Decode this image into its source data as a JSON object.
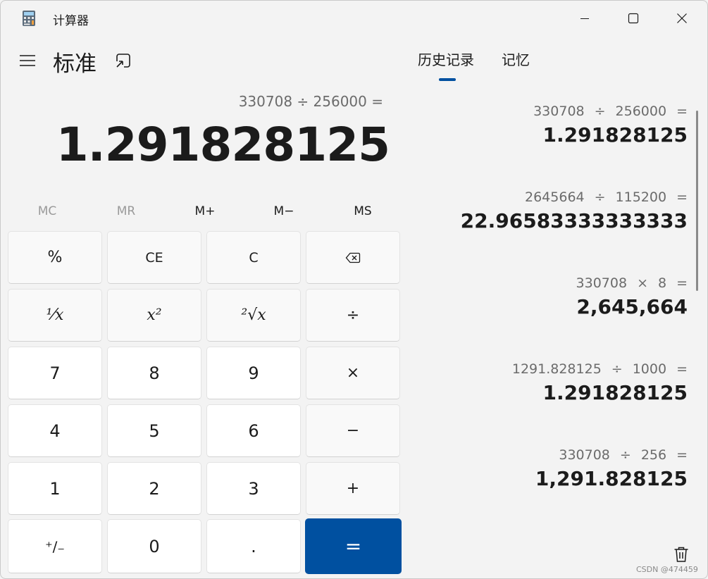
{
  "window": {
    "title": "计算器",
    "controls": {
      "minimize": "minimize-icon",
      "maximize": "maximize-icon",
      "close": "close-icon"
    }
  },
  "header": {
    "mode_title": "标准",
    "menu_icon": "hamburger-icon",
    "keep_on_top_icon": "overlay-icon"
  },
  "display": {
    "expression": "330708 ÷ 256000 =",
    "result": "1.291828125"
  },
  "memory_buttons": [
    {
      "label": "MC",
      "enabled": false
    },
    {
      "label": "MR",
      "enabled": false
    },
    {
      "label": "M+",
      "enabled": true
    },
    {
      "label": "M−",
      "enabled": true
    },
    {
      "label": "MS",
      "enabled": true
    }
  ],
  "keypad": {
    "percent": "%",
    "clear_entry": "CE",
    "clear": "C",
    "backspace_icon": "backspace-icon",
    "reciprocal": "¹⁄x",
    "square": "x²",
    "sqrt": "²√x",
    "divide": "÷",
    "d7": "7",
    "d8": "8",
    "d9": "9",
    "multiply": "×",
    "d4": "4",
    "d5": "5",
    "d6": "6",
    "subtract": "−",
    "d1": "1",
    "d2": "2",
    "d3": "3",
    "add": "+",
    "negate": "⁺∕₋",
    "d0": "0",
    "decimal": ".",
    "equals": "="
  },
  "tabs": [
    {
      "label": "历史记录",
      "active": true
    },
    {
      "label": "记忆",
      "active": false
    }
  ],
  "history": [
    {
      "a": "330708",
      "op": "÷",
      "b": "256000",
      "eq": "=",
      "result": "1.291828125"
    },
    {
      "a": "2645664",
      "op": "÷",
      "b": "115200",
      "eq": "=",
      "result": "22.96583333333333"
    },
    {
      "a": "330708",
      "op": "×",
      "b": "8",
      "eq": "=",
      "result": "2,645,664"
    },
    {
      "a": "1291.828125",
      "op": "÷",
      "b": "1000",
      "eq": "=",
      "result": "1.291828125"
    },
    {
      "a": "330708",
      "op": "÷",
      "b": "256",
      "eq": "=",
      "result": "1,291.828125"
    }
  ],
  "trash_icon": "trash-icon",
  "watermark": "CSDN @474459",
  "colors": {
    "accent": "#0050a0",
    "background": "#f3f3f3"
  }
}
